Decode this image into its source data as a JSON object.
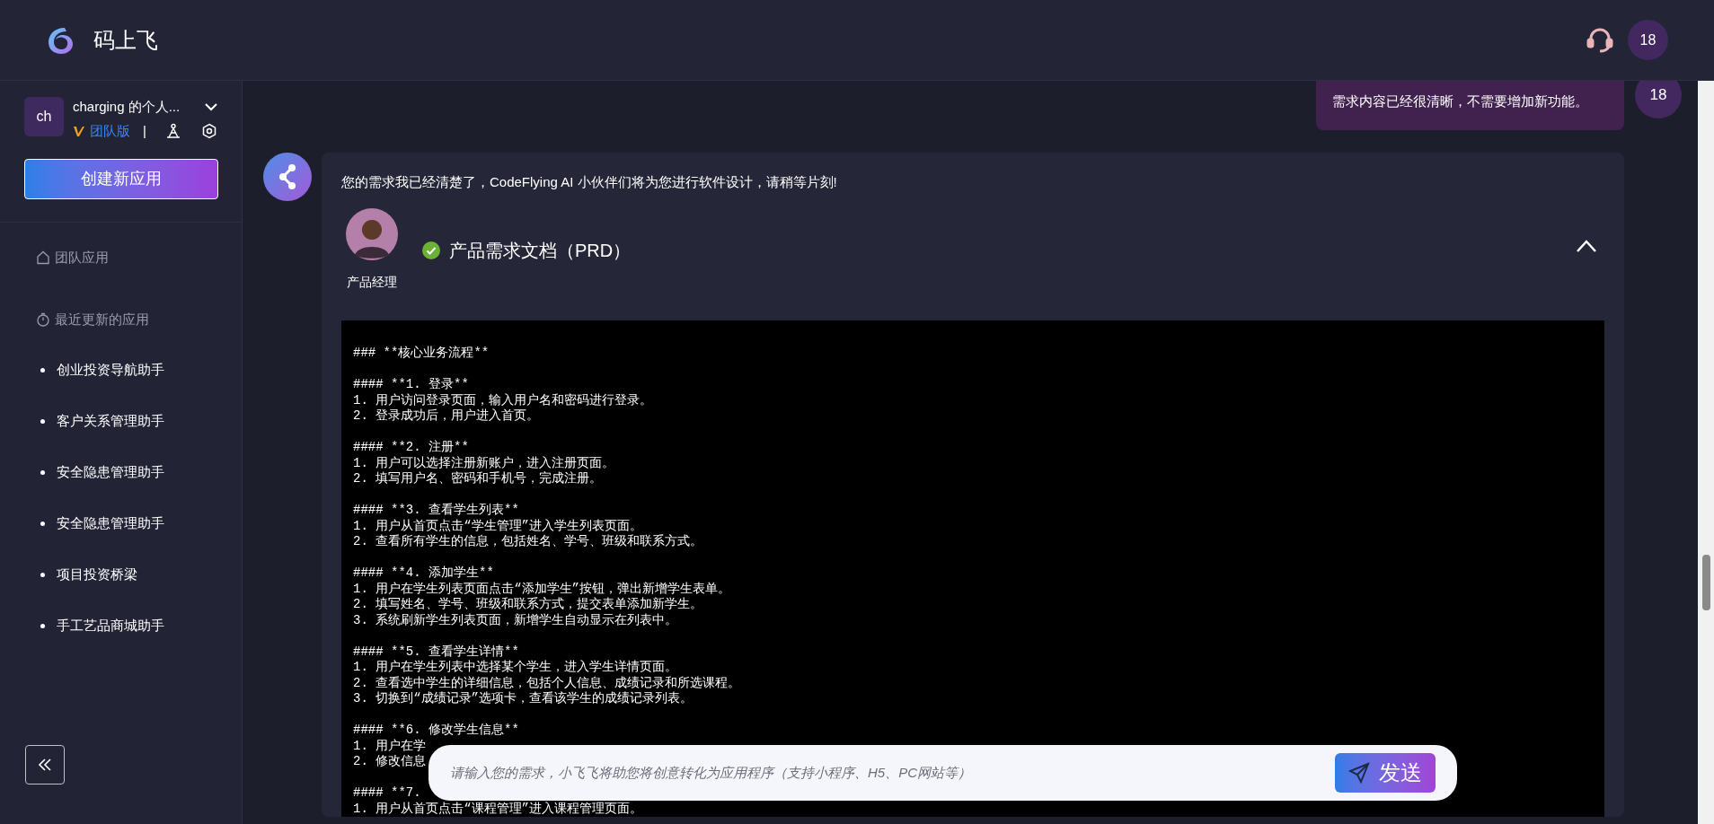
{
  "header": {
    "logo_text": "码上飞",
    "user_avatar": "18"
  },
  "sidebar": {
    "workspace": {
      "avatar": "ch",
      "name": "charging 的个人...",
      "plan": "团队版",
      "separator": "|"
    },
    "create_button": "创建新应用",
    "sections": [
      {
        "label": "团队应用",
        "kind": "home"
      },
      {
        "label": "最近更新的应用",
        "kind": "timer"
      }
    ],
    "apps": [
      "创业投资导航助手",
      "客户关系管理助手",
      "安全隐患管理助手",
      "安全隐患管理助手",
      "项目投资桥梁",
      "手工艺品商城助手"
    ]
  },
  "chat": {
    "messages": [
      {
        "kind": "user",
        "text": "需求内容已经很清晰，不需要增加新功能。",
        "avatar": "18"
      },
      {
        "kind": "assistant",
        "text": "您的需求我已经清楚了，CodeFlying AI 小伙伴们将为您进行软件设计，请稍等片刻!",
        "agent": {
          "role": "产品经理",
          "completed": true,
          "title": "产品需求文档（PRD）",
          "expanded": true,
          "document_blocks": [
            [
              "### **核心业务流程**"
            ],
            [
              "#### **1. 登录**",
              "1. 用户访问登录页面，输入用户名和密码进行登录。",
              "2. 登录成功后，用户进入首页。"
            ],
            [
              "#### **2. 注册**",
              "1. 用户可以选择注册新账户，进入注册页面。",
              "2. 填写用户名、密码和手机号，完成注册。"
            ],
            [
              "#### **3. 查看学生列表**",
              "1. 用户从首页点击“学生管理”进入学生列表页面。",
              "2. 查看所有学生的信息，包括姓名、学号、班级和联系方式。"
            ],
            [
              "#### **4. 添加学生**",
              "1. 用户在学生列表页面点击“添加学生”按钮，弹出新增学生表单。",
              "2. 填写姓名、学号、班级和联系方式，提交表单添加新学生。",
              "3. 系统刷新学生列表页面，新增学生自动显示在列表中。"
            ],
            [
              "#### **5. 查看学生详情**",
              "1. 用户在学生列表中选择某个学生，进入学生详情页面。",
              "2. 查看选中学生的详细信息，包括个人信息、成绩记录和所选课程。",
              "3. 切换到“成绩记录”选项卡，查看该学生的成绩记录列表。"
            ],
            [
              "#### **6. 修改学生信息**",
              "1. 用户在学",
              "2. 修改信息"
            ],
            [
              "#### **7.",
              "1. 用户从首页点击“课程管理”进入课程管理页面。"
            ]
          ]
        }
      }
    ]
  },
  "input": {
    "placeholder": "请输入您的需求，小飞飞将助您将创意转化为应用程序（支持小程序、H5、PC网站等）",
    "send_button": "发送"
  }
}
